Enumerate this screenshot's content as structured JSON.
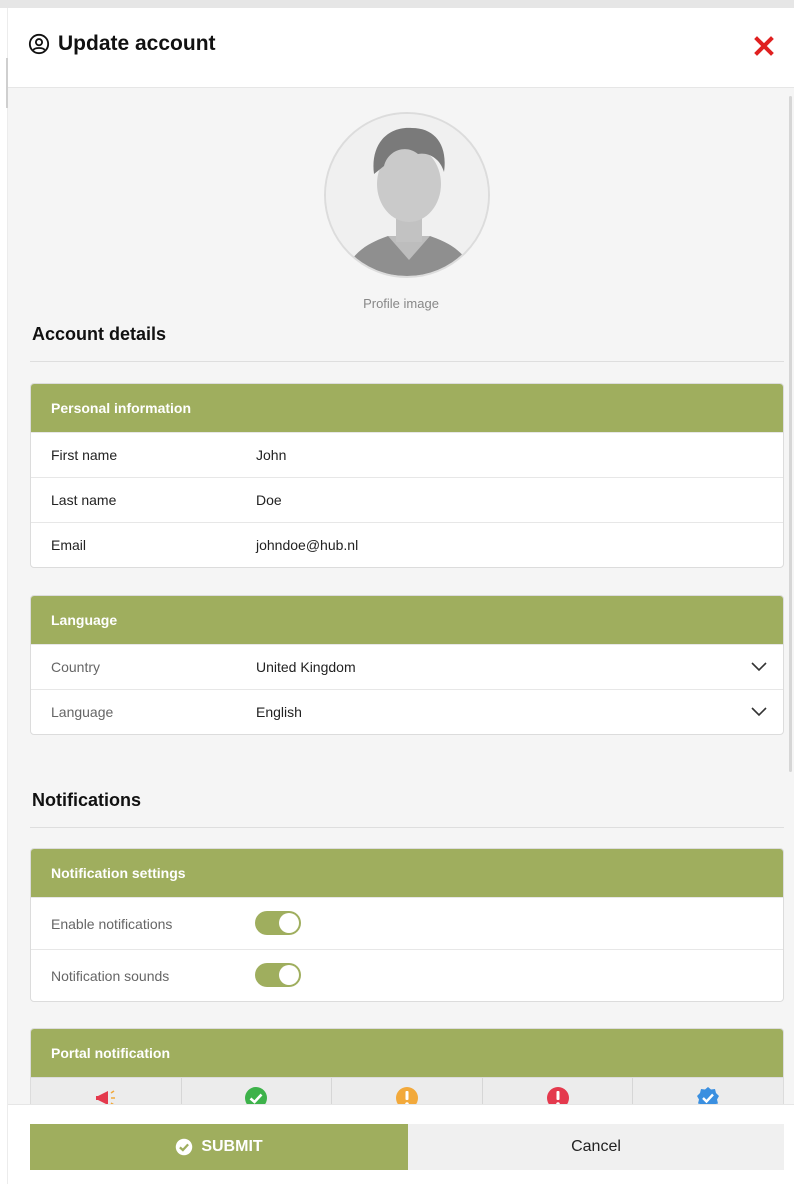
{
  "modal": {
    "title": "Update account",
    "title_icon": "user-circle-icon",
    "close_icon": "close-icon"
  },
  "profile": {
    "caption": "Profile image",
    "avatar_icon": "avatar-placeholder"
  },
  "account_details": {
    "section_title": "Account details",
    "personal": {
      "header": "Personal information",
      "rows": [
        {
          "label": "First name",
          "value": "John"
        },
        {
          "label": "Last name",
          "value": "Doe"
        },
        {
          "label": "Email",
          "value": "johndoe@hub.nl"
        }
      ]
    },
    "language": {
      "header": "Language",
      "rows": [
        {
          "label": "Country",
          "value": "United Kingdom"
        },
        {
          "label": "Language",
          "value": "English"
        }
      ]
    }
  },
  "notifications": {
    "section_title": "Notifications",
    "settings": {
      "header": "Notification settings",
      "rows": [
        {
          "label": "Enable notifications",
          "enabled": true
        },
        {
          "label": "Notification sounds",
          "enabled": true
        }
      ]
    },
    "portal": {
      "header": "Portal notification",
      "icons": [
        "megaphone-icon",
        "check-circle-icon",
        "warning-icon",
        "error-icon",
        "verified-badge-icon"
      ]
    }
  },
  "footer": {
    "submit_label": "SUBMIT",
    "cancel_label": "Cancel"
  },
  "colors": {
    "accent": "#9fae5e",
    "close": "#e02020",
    "success": "#3db24a",
    "warning": "#f2a93b",
    "error": "#e4394d",
    "info": "#3a8fe0"
  }
}
